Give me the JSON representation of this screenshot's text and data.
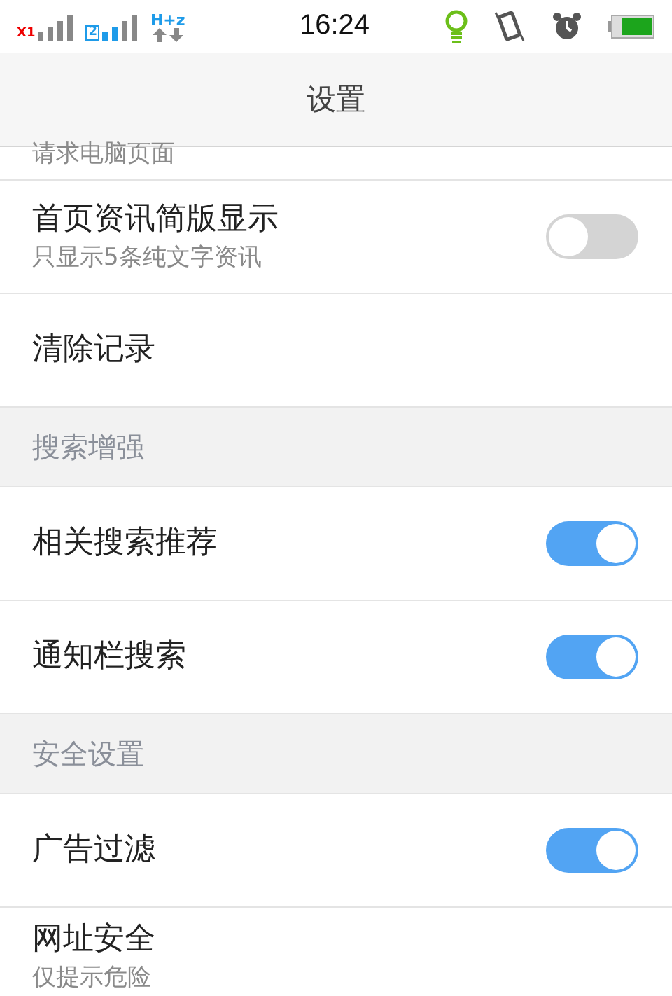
{
  "status_bar": {
    "sim1_label": "X1",
    "sim2_label": "2",
    "network_label": "H+z",
    "time": "16:24"
  },
  "header": {
    "title": "设置"
  },
  "items": [
    {
      "kind": "partial",
      "subtitle": "请求电脑页面"
    },
    {
      "kind": "toggle",
      "title": "首页资讯简版显示",
      "subtitle": "只显示5条纯文字资讯",
      "on": false
    },
    {
      "kind": "plain",
      "title": "清除记录"
    },
    {
      "kind": "section",
      "title": "搜索增强"
    },
    {
      "kind": "toggle",
      "title": "相关搜索推荐",
      "on": true
    },
    {
      "kind": "toggle",
      "title": "通知栏搜索",
      "on": true
    },
    {
      "kind": "section",
      "title": "安全设置"
    },
    {
      "kind": "toggle",
      "title": "广告过滤",
      "on": true
    },
    {
      "kind": "plain",
      "title": "网址安全",
      "subtitle": "仅提示危险"
    }
  ]
}
